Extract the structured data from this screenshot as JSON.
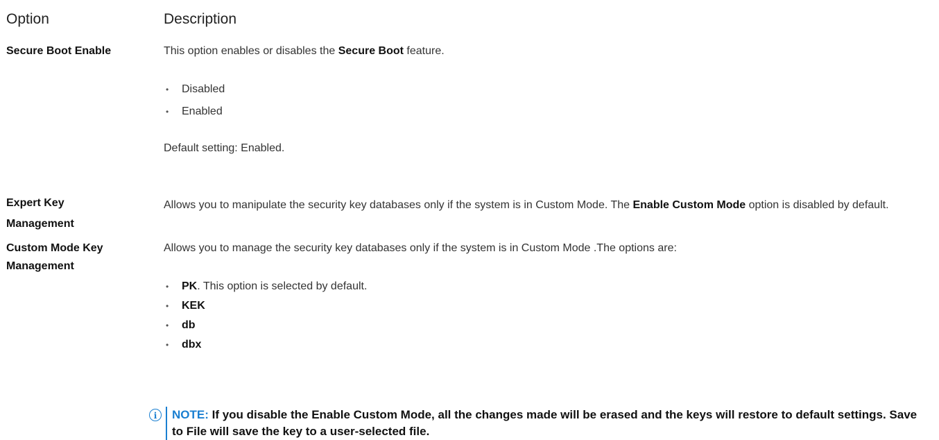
{
  "table": {
    "header": {
      "option": "Option",
      "description": "Description"
    },
    "rows": [
      {
        "option": "Secure Boot Enable",
        "desc_pre": "This option enables or disables the ",
        "desc_bold": "Secure Boot",
        "desc_post": " feature.",
        "choices": [
          "Disabled",
          "Enabled"
        ],
        "default": "Default setting: Enabled."
      },
      {
        "option_line1": "Expert Key",
        "option_line2": "Management",
        "desc_pre": "Allows you to manipulate the security key databases only if the system is in Custom Mode. The ",
        "desc_bold": "Enable Custom Mode",
        "desc_post": " option is disabled by default."
      },
      {
        "option_line1": "Custom Mode Key",
        "option_line2": "Management",
        "desc": "Allows you to manage the security key databases only if the system is in Custom Mode .The options are:",
        "choices": [
          {
            "bold": "PK",
            "rest": ". This option is selected by default."
          },
          {
            "bold": "KEK",
            "rest": ""
          },
          {
            "bold": "db",
            "rest": ""
          },
          {
            "bold": "dbx",
            "rest": ""
          }
        ]
      }
    ]
  },
  "note": {
    "icon": "info-icon",
    "label": "NOTE:",
    "text": " If you disable the Enable Custom Mode, all the changes made will be erased and the keys will restore to default settings. Save to File will save the key to a user-selected file."
  },
  "colors": {
    "accent": "#1a7fd1",
    "text": "#333333"
  }
}
